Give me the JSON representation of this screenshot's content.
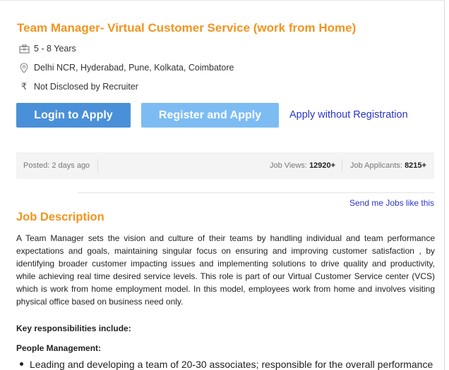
{
  "job": {
    "title": "Team Manager- Virtual Customer Service (work from Home)",
    "experience": "5 - 8 Years",
    "locations": "Delhi NCR, Hyderabad, Pune, Kolkata, Coimbatore",
    "salary": "Not Disclosed by Recruiter"
  },
  "icons": {
    "experience": "briefcase-icon",
    "location": "location-pin-icon",
    "salary": "rupee-icon"
  },
  "actions": {
    "login_apply": "Login to Apply",
    "register_apply": "Register and Apply",
    "apply_without_registration": "Apply without Registration"
  },
  "stats": {
    "posted": "Posted: 2 days ago",
    "views_label": "Job Views:",
    "views_value": "12920+",
    "applicants_label": "Job Applicants:",
    "applicants_value": "8215+"
  },
  "send_jobs_link": "Send me Jobs like this",
  "description": {
    "heading": "Job Description",
    "paragraph": "A Team Manager sets the vision and culture of their teams by handling individual and team performance expectations and goals, maintaining singular focus on ensuring and improving customer satisfaction , by identifying broader customer impacting issues and implementing solutions to drive quality and productivity, while achieving real time desired service levels. This role is part of our Virtual Customer Service center (VCS) which is work from home employment model. In this model, employees work from home and involves visiting physical office based on business need only.",
    "key_responsibilities": "Key responsibilities include:",
    "people_management": "People Management:",
    "bullets": [
      "Leading and developing a team of 20-30 associates; responsible for the overall performance"
    ]
  },
  "colors": {
    "accent_orange": "#f2941f",
    "login_button": "#4a90d9",
    "register_button": "#7dbcf3",
    "link_blue": "#2b35c8"
  }
}
